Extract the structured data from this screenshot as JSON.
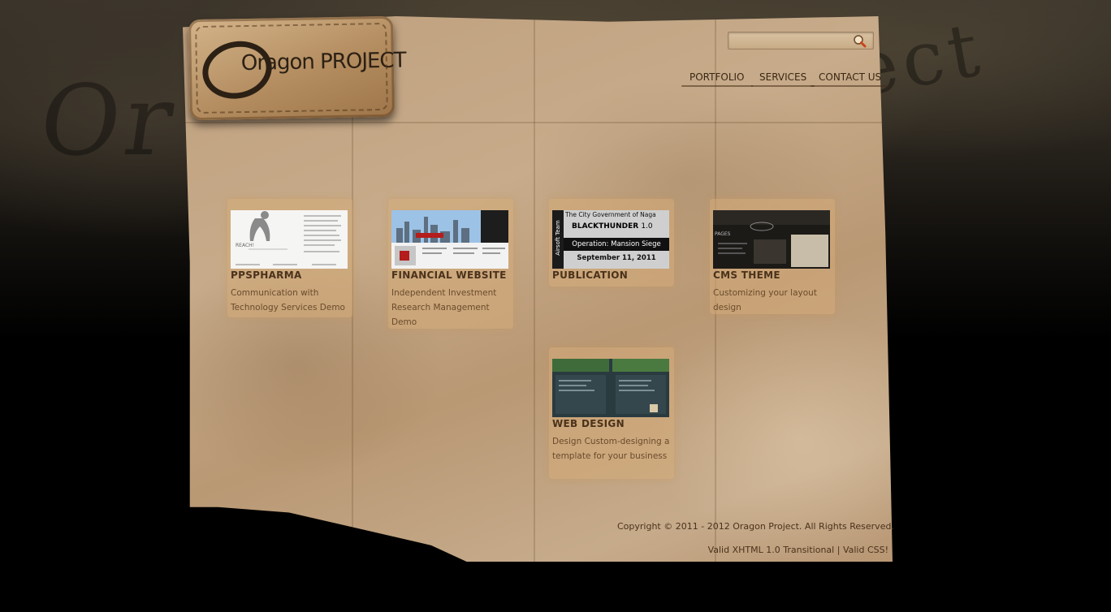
{
  "site": {
    "logo_text": "Oragon PROJECT",
    "background_word": "Oragon Project"
  },
  "search": {
    "value": "",
    "placeholder": "",
    "icon": "search-icon"
  },
  "nav": [
    {
      "label": "PORTFOLIO"
    },
    {
      "label": "SERVICES"
    },
    {
      "label": "CONTACT US"
    }
  ],
  "portfolio": [
    {
      "title": "PPSPHARMA",
      "description": "Communication with Technology Services Demo",
      "thumb_caption": "REACH!"
    },
    {
      "title": "FINANCIAL WEBSITE",
      "description": "Independent Investment Research Management Demo",
      "thumb_caption": ""
    },
    {
      "title": "PUBLICATION",
      "description": "",
      "thumb": {
        "top_line": "The City Government of Naga",
        "title": "BLACKTHUNDER",
        "version": "1.0",
        "subtitle": "Operation: Mansion Siege",
        "date": "September 11, 2011",
        "side": "Airsoft Team"
      }
    },
    {
      "title": "CMS THEME",
      "description": "Customizing your layout design",
      "thumb_caption": "PAGES"
    },
    {
      "title": "WEB DESIGN",
      "description": "Design Custom-designing a template for your business",
      "thumb_caption": ""
    }
  ],
  "footer": {
    "copyright": "Copyright © 2011 - 2012 Oragon Project. All Rights Reserved.",
    "valid_xhtml": "Valid XHTML 1.0 Transitional",
    "separator": " | ",
    "valid_css": "Valid CSS!"
  },
  "colors": {
    "paper": "#c1a37f",
    "ink": "#4a321b",
    "background": "#000000"
  }
}
